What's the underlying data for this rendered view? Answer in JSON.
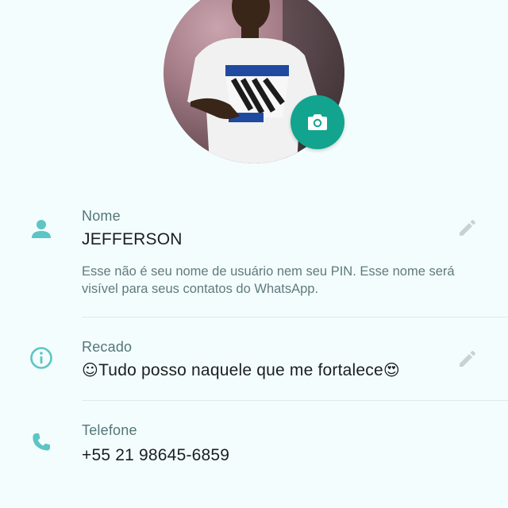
{
  "profile": {
    "photo_alt": "",
    "camera_icon": "camera-icon"
  },
  "name_section": {
    "icon": "person-icon",
    "label": "Nome",
    "value": "JEFFERSON",
    "hint": "Esse não é seu nome de usuário nem seu PIN. Esse nome será visível para seus contatos do WhatsApp.",
    "edit_icon": "pencil-icon"
  },
  "about_section": {
    "icon": "info-icon",
    "label": "Recado",
    "emoji_start": "☺",
    "value": "Tudo posso naquele que me fortalece",
    "emoji_end": "😍",
    "edit_icon": "pencil-icon"
  },
  "phone_section": {
    "icon": "phone-icon",
    "label": "Telefone",
    "value": "+55 21 98645-6859"
  },
  "colors": {
    "accent": "#12a48e",
    "icon": "#5cc5c5",
    "label": "#52767a",
    "background": "#f4fdfd"
  }
}
